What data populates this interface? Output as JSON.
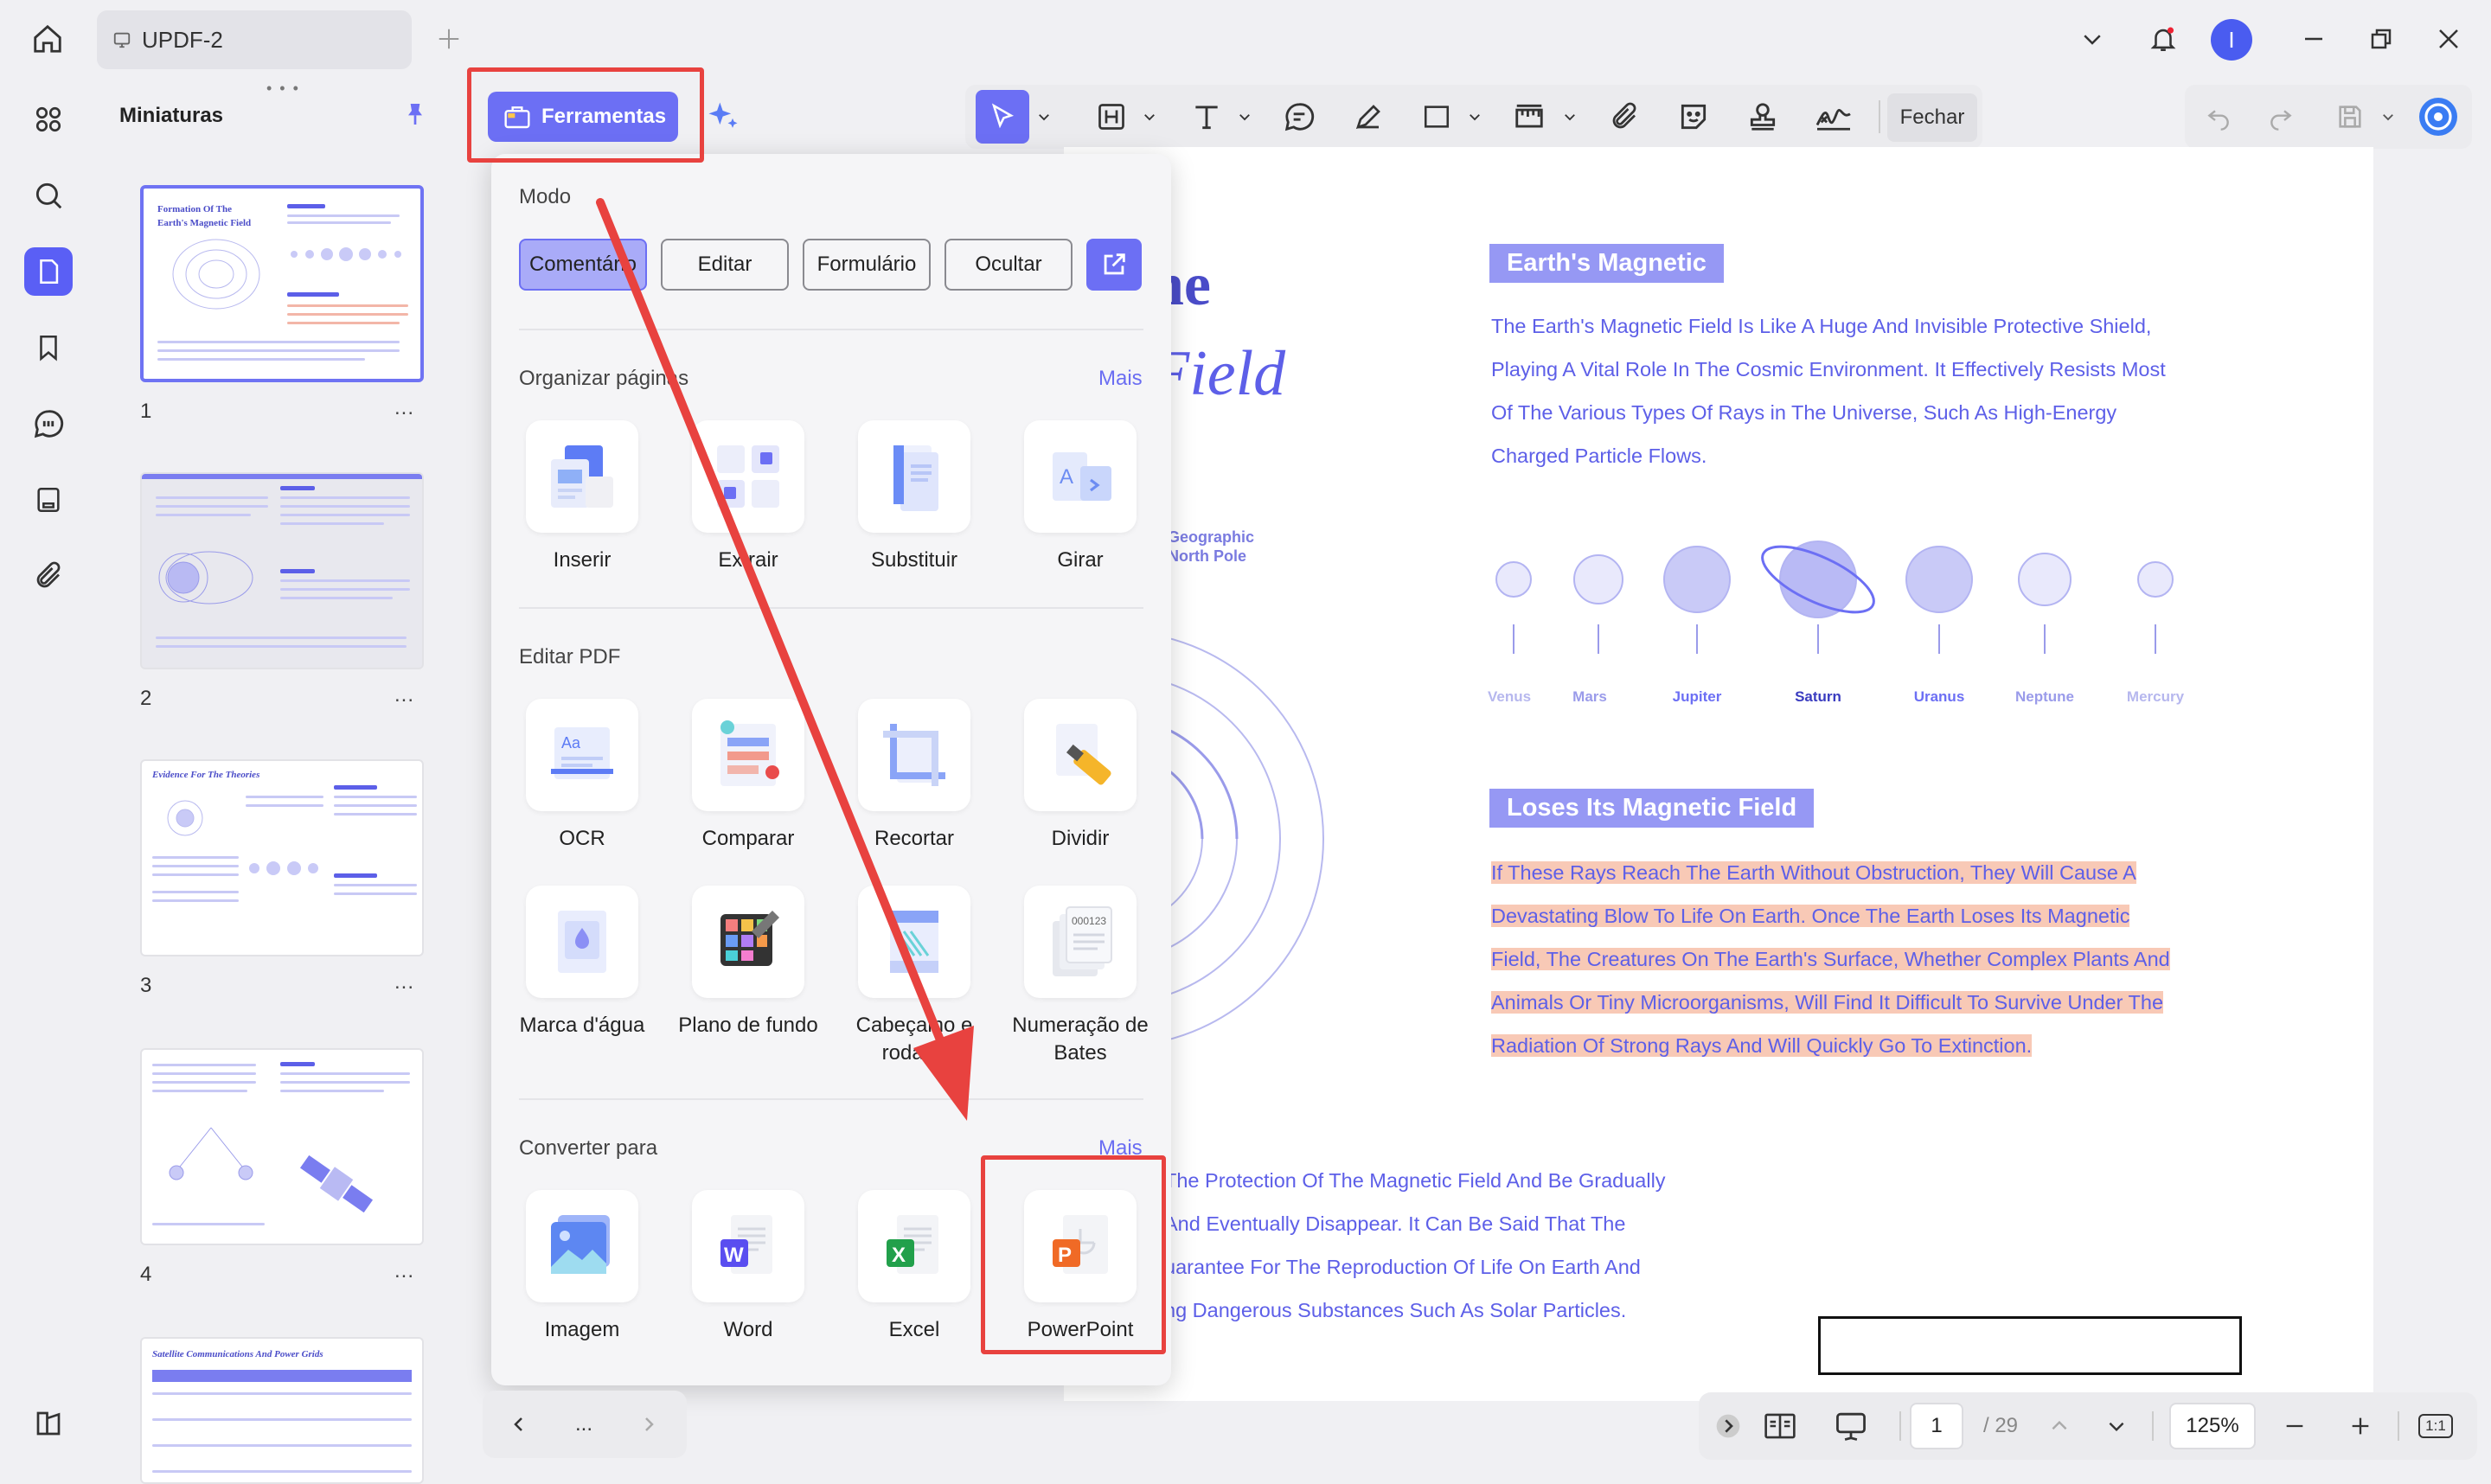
{
  "titlebar": {
    "tab_title": "UPDF-2",
    "avatar_letter": "I"
  },
  "thumbnails": {
    "title": "Miniaturas",
    "pages": [
      {
        "num": "1",
        "heading": "Formation Of The Earth's Magnetic Field"
      },
      {
        "num": "2",
        "heading": ""
      },
      {
        "num": "3",
        "heading": "Evidence For The Theories"
      },
      {
        "num": "4",
        "heading": ""
      },
      {
        "num": "",
        "heading": "Satellite Communications And Power Grids"
      }
    ],
    "more": "..."
  },
  "toolbar": {
    "tools_label": "Ferramentas",
    "close_label": "Fechar"
  },
  "popup": {
    "mode_title": "Modo",
    "modes": [
      "Comentário",
      "Editar",
      "Formulário",
      "Ocultar"
    ],
    "organize": {
      "title": "Organizar páginas",
      "more": "Mais",
      "items": [
        "Inserir",
        "Extrair",
        "Substituir",
        "Girar"
      ]
    },
    "edit": {
      "title": "Editar PDF",
      "items": [
        "OCR",
        "Comparar",
        "Recortar",
        "Dividir",
        "Marca d'água",
        "Plano de fundo",
        "Cabeçalho e rodapé",
        "Numeração de Bates"
      ]
    },
    "convert": {
      "title": "Converter para",
      "more": "Mais",
      "items": [
        "Imagem",
        "Word",
        "Excel",
        "PowerPoint"
      ]
    }
  },
  "document": {
    "title_frag_1": "he",
    "title_frag_2": "Field",
    "section1_heading": "Earth's Magnetic",
    "section1_lines": [
      "The Earth's Magnetic Field Is Like A Huge And Invisible Protective Shield,",
      "Playing A Vital Role In The Cosmic Environment. It Effectively Resists Most",
      "Of The Various Types Of Rays in The Universe, Such As High-Energy",
      "Charged Particle Flows."
    ],
    "geo_label_1": "Geographic",
    "geo_label_2": "North Pole",
    "planets": [
      "Venus",
      "Mars",
      "Jupiter",
      "Saturn",
      "Uranus",
      "Neptune",
      "Mercury"
    ],
    "section2_heading": "Loses Its Magnetic Field",
    "section2_lines": [
      "If These Rays Reach The Earth Without Obstruction, They Will Cause A",
      "Devastating Blow To Life On Earth. Once The Earth Loses Its Magnetic",
      "Field, The Creatures On The Earth's Surface, Whether Complex Plants And",
      "Animals Or Tiny Microorganisms, Will Find It Difficult To Survive Under The",
      "Radiation Of Strong Rays And Will Quickly Go To Extinction."
    ],
    "section3_lines": [
      "The Protection Of The Magnetic Field And Be Gradually",
      "And Eventually Disappear. It Can Be Said That The",
      "uarantee For The Reproduction Of Life On Earth And",
      "ng Dangerous Substances Such As Solar Particles."
    ]
  },
  "pagenav": {
    "dots": "..."
  },
  "bottombar": {
    "page_current": "1",
    "page_total": "/ 29",
    "zoom": "125%",
    "fit_label": "1:1"
  },
  "colors": {
    "accent": "#6c6ff4",
    "highlight_red": "#e8423f",
    "doc_text": "#5d5fe8",
    "highlight_bg": "#f8c9b6"
  }
}
